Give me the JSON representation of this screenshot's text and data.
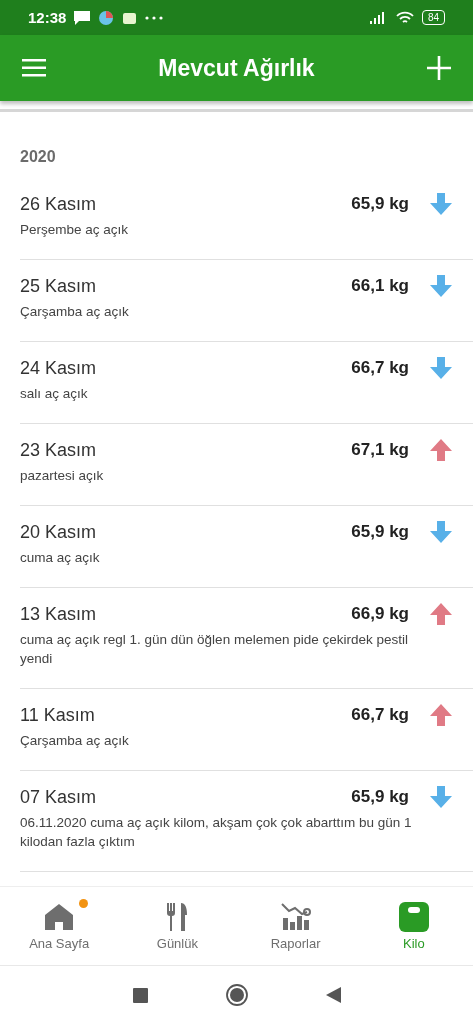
{
  "status_bar": {
    "time": "12:38",
    "battery": "84"
  },
  "app_bar": {
    "title": "Mevcut Ağırlık"
  },
  "year": "2020",
  "entries": [
    {
      "kind": "down",
      "date": "26 Kasım",
      "note": "Perşembe aç açık",
      "weight": "65,9 kg"
    },
    {
      "kind": "down",
      "date": "25 Kasım",
      "note": "Çarşamba aç açık",
      "weight": "66,1 kg"
    },
    {
      "kind": "down",
      "date": "24 Kasım",
      "note": "salı aç açık",
      "weight": "66,7 kg"
    },
    {
      "kind": "up",
      "date": "23 Kasım",
      "note": "pazartesi açık",
      "weight": "67,1 kg"
    },
    {
      "kind": "down",
      "date": "20 Kasım",
      "note": "cuma aç açık",
      "weight": "65,9 kg"
    },
    {
      "kind": "up",
      "date": "13 Kasım",
      "note": "cuma aç açık regl 1. gün dün öğlen melemen pide çekirdek pestil yendi",
      "weight": "66,9 kg"
    },
    {
      "kind": "up",
      "date": "11 Kasım",
      "note": "Çarşamba aç açık",
      "weight": "66,7 kg"
    },
    {
      "kind": "down",
      "date": "07 Kasım",
      "note": "06.11.2020 cuma aç açık kilom, akşam çok çok abarttım bu gün 1 kilodan fazla çıktım",
      "weight": "65,9 kg"
    }
  ],
  "bottom_nav": [
    {
      "kind": "home",
      "label": "Ana Sayfa",
      "selected": false,
      "badge": true
    },
    {
      "kind": "diary",
      "label": "Günlük",
      "selected": false,
      "badge": false
    },
    {
      "kind": "reports",
      "label": "Raporlar",
      "selected": false,
      "badge": false
    },
    {
      "kind": "weight",
      "label": "Kilo",
      "selected": true,
      "badge": false
    }
  ]
}
